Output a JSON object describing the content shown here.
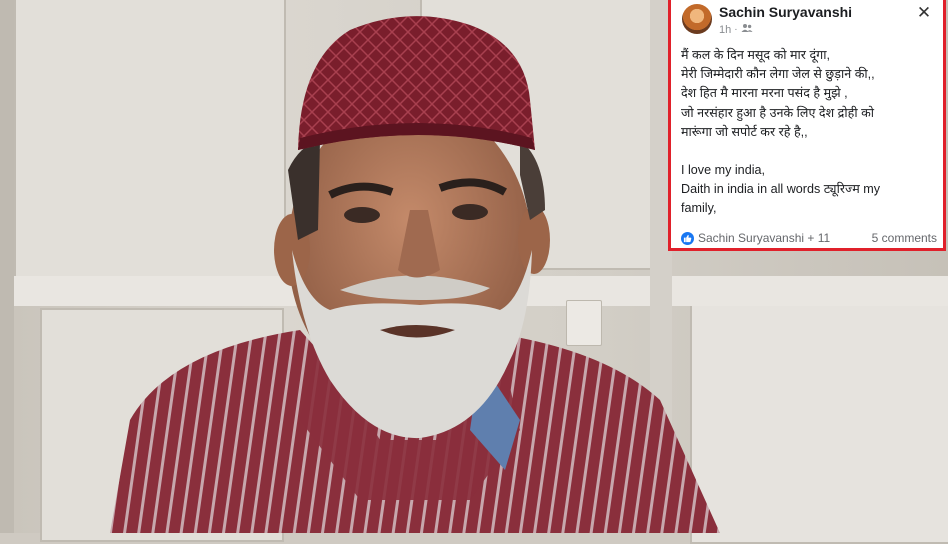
{
  "post": {
    "author": "Sachin Suryavanshi",
    "time": "1h",
    "lines": [
      "मैं कल के दिन मसूद को मार दूंगा,",
      "मेरी जिम्मेदारी कौन लेगा जेल से छुड़ाने की,,",
      "देश हित मै मारना मरना पसंद है मुझे ,",
      "जो नरसंहार हुआ है उनके लिए देश द्रोही को",
      "मारूंगा जो सपोर्ट कर रहे है,,",
      "",
      "I love my india,",
      "Daith in india in all words ट्यूरिज्म my",
      "family,"
    ],
    "reactions_text": "Sachin Suryavanshi + 11",
    "comments_text": "5 comments"
  },
  "colors": {
    "card_border": "#e0202a",
    "like_blue": "#1877f2",
    "cap": "#7a1e2c",
    "shirt": "#8a2f3c"
  },
  "icons": {
    "close": "close-icon",
    "audience": "friends-audience-icon",
    "like": "like-icon",
    "avatar": "avatar"
  }
}
